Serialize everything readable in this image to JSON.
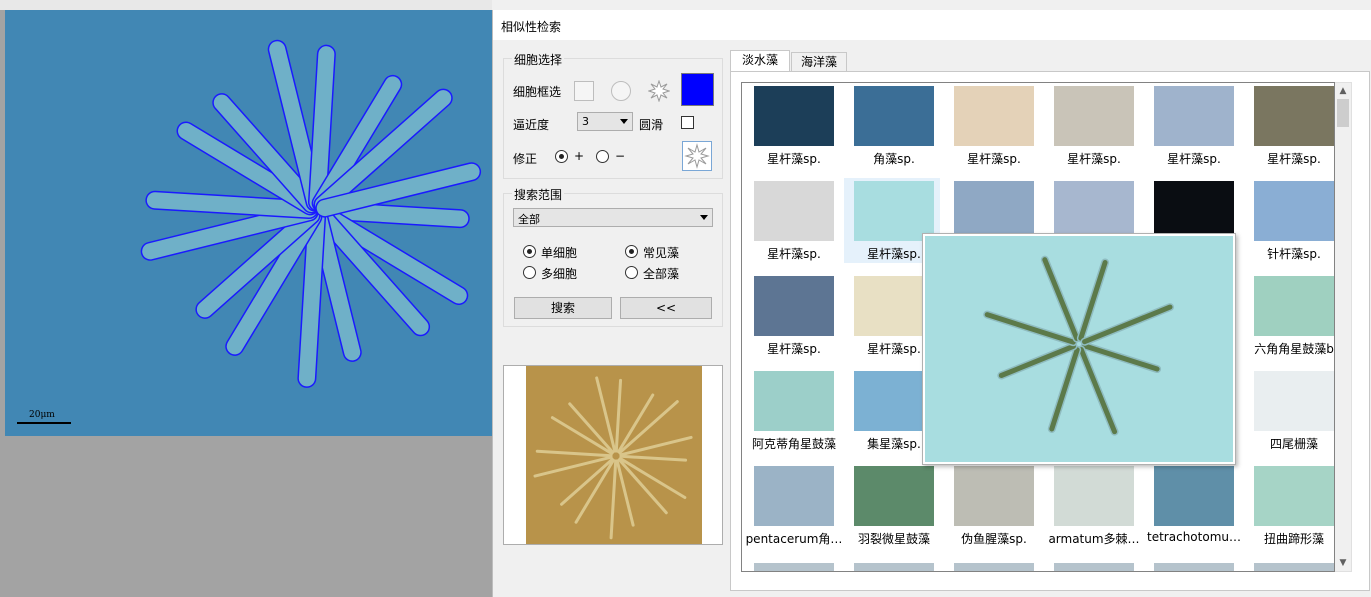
{
  "viewer": {
    "scale_label": "20μm",
    "background_color": "#4187b4",
    "contour_color": "#1a1aff"
  },
  "dialog": {
    "title": "相似性检索",
    "cell_select": {
      "group_label": "细胞选择",
      "frame_label": "细胞框选",
      "shape_icons": [
        "square-shape-icon",
        "circle-shape-icon",
        "star-shape-icon"
      ],
      "frame_color": "#0000ff",
      "approx_label": "逼近度",
      "approx_value": "3",
      "smooth_label": "圆滑",
      "smooth_checked": false,
      "fix_label": "修正",
      "fix_plus": "+",
      "fix_minus": "−",
      "fix_plus_selected": true
    },
    "search_range": {
      "group_label": "搜索范围",
      "scope_value": "全部",
      "single_cell": "单细胞",
      "multi_cell": "多细胞",
      "common": "常见藻",
      "all_algae": "全部藻",
      "single_selected": true,
      "common_selected": true,
      "search_button": "搜索",
      "collapse_button": "<<"
    },
    "tabs": [
      {
        "label": "淡水藻",
        "active": true
      },
      {
        "label": "海洋藻",
        "active": false
      }
    ],
    "results": [
      {
        "label": "星杆藻sp.",
        "color": "#1c3e58"
      },
      {
        "label": "角藻sp.",
        "color": "#3b6e96"
      },
      {
        "label": "星杆藻sp.",
        "color": "#e4d2b8"
      },
      {
        "label": "星杆藻sp.",
        "color": "#c9c4b8"
      },
      {
        "label": "星杆藻sp.",
        "color": "#9fb3cc"
      },
      {
        "label": "星杆藻sp.",
        "color": "#7a7660"
      },
      {
        "label": "星杆藻sp.",
        "color": "#d8d8d8"
      },
      {
        "label": "星杆藻sp.",
        "color": "#a8dde0"
      },
      {
        "label": "",
        "color": "#8fa8c4"
      },
      {
        "label": "",
        "color": "#a7b7cf"
      },
      {
        "label": "",
        "color": "#0a0d12"
      },
      {
        "label": "针杆藻sp.",
        "color": "#8aaed4"
      },
      {
        "label": "星杆藻sp.",
        "color": "#5d7593"
      },
      {
        "label": "星杆藻sp.",
        "color": "#e8e0c4"
      },
      {
        "label": "",
        "color": "#ffffff"
      },
      {
        "label": "",
        "color": "#ffffff"
      },
      {
        "label": "",
        "color": "#ffffff"
      },
      {
        "label": "六角角星鼓藻b",
        "color": "#9fd0c0"
      },
      {
        "label": "阿克蒂角星鼓藻",
        "color": "#9ccfc9"
      },
      {
        "label": "集星藻sp.",
        "color": "#7cb1d3"
      },
      {
        "label": "",
        "color": "#ffffff"
      },
      {
        "label": "",
        "color": "#ffffff"
      },
      {
        "label": "",
        "color": "#ffffff"
      },
      {
        "label": "四尾栅藻",
        "color": "#e9eef0"
      },
      {
        "label": "pentacerum角…",
        "color": "#9bb3c6"
      },
      {
        "label": "羽裂微星鼓藻",
        "color": "#5c8a6a"
      },
      {
        "label": "伪鱼腥藻sp.",
        "color": "#bdbdb4"
      },
      {
        "label": "armatum多棘…",
        "color": "#d2dbd6"
      },
      {
        "label": "tetrachotomu…",
        "color": "#5f8fa8"
      },
      {
        "label": "扭曲蹄形藻",
        "color": "#a6d4c6"
      }
    ],
    "popup_color": "#a8dde0"
  }
}
